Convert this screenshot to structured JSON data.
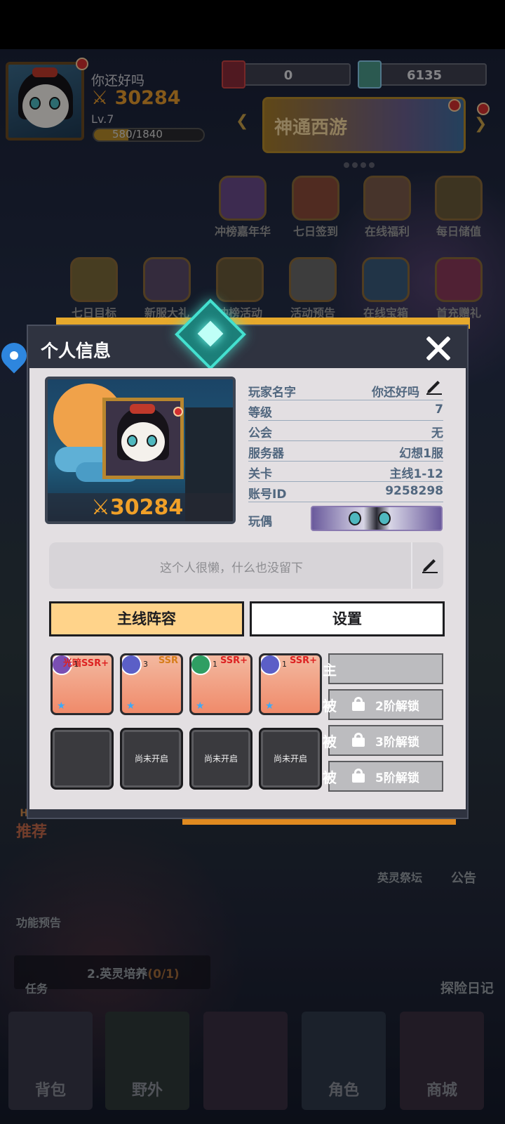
{
  "header": {
    "player_name": "你还好吗",
    "power": "30284",
    "level": "Lv.7",
    "exp_text": "580/1840",
    "exp_progress": 0.315,
    "currency_1": "0",
    "currency_2": "6135",
    "banner_text": "神通西游"
  },
  "features_row1": [
    "冲榜嘉年华",
    "七日签到",
    "在线福利",
    "每日储值"
  ],
  "features_row2": [
    "七日目标",
    "新服大礼",
    "冲榜活动",
    "活动预告",
    "在线宝箱",
    "首充赠礼"
  ],
  "side": {
    "recommend": "推荐",
    "hot": "HOT",
    "preview": "功能预告",
    "task": "任务",
    "task_text": "2.英灵培养",
    "task_progress": "(0/1)",
    "altar": "英灵祭坛",
    "notice": "公告",
    "journal": "探险日记"
  },
  "bottom_nav": [
    "背包",
    "野外",
    "",
    "角色",
    "商城"
  ],
  "dialog": {
    "title": "个人信息",
    "power": "30284",
    "info": [
      {
        "key": "玩家名字",
        "value": "你还好吗"
      },
      {
        "key": "等级",
        "value": "7"
      },
      {
        "key": "公会",
        "value": "无"
      },
      {
        "key": "服务器",
        "value": "幻想1服"
      },
      {
        "key": "关卡",
        "value": "主线1-12"
      },
      {
        "key": "账号ID",
        "value": "9258298"
      }
    ],
    "doll_label": "玩偶",
    "bio": "这个人很懒，什么也没留下",
    "tabs": [
      "主线阵容",
      "设置"
    ],
    "heroes": [
      {
        "tag": "光暗SSR+",
        "level": "1",
        "badge_color": "#7a4fb3"
      },
      {
        "tag": "SSR",
        "level": "3",
        "badge_color": "#5b5fc7"
      },
      {
        "tag": "SSR+",
        "level": "1",
        "badge_color": "#2f9e63"
      },
      {
        "tag": "SSR+",
        "level": "1",
        "badge_color": "#5b5fc7"
      }
    ],
    "empty_slots": [
      "",
      "尚未开启",
      "尚未开启",
      "尚未开启"
    ],
    "skills": [
      {
        "label": "主",
        "text": ""
      },
      {
        "label": "被",
        "text": "2阶解锁"
      },
      {
        "label": "被",
        "text": "3阶解锁"
      },
      {
        "label": "被",
        "text": "5阶解锁"
      }
    ]
  },
  "colors": {
    "accent_gold": "#e6a92c",
    "tab_active": "#ffd38a",
    "info_text": "#51677f"
  }
}
